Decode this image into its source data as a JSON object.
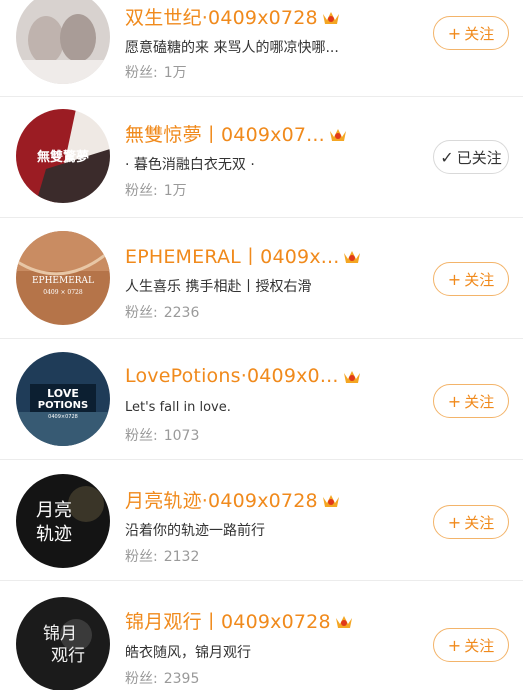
{
  "colors": {
    "name_orange": "#f08a1c",
    "follow_border": "#f3b46a",
    "fans_gray": "#9a9a9a",
    "followed_border": "#d9d9d9"
  },
  "fans_label": "粉丝:",
  "items": [
    {
      "name": "双生世纪·0409x0728",
      "bio": "愿意磕糖的来 来骂人的哪凉快哪...",
      "fans": "1万",
      "button": {
        "icon": "+",
        "label": "关注"
      }
    },
    {
      "name": "無雙惊夢丨0409x07...",
      "bio": "· 暮色消融白衣无双 ·",
      "fans": "1万",
      "button": {
        "icon": "✓",
        "label": "已关注"
      },
      "avatar_text": "無雙驚夢"
    },
    {
      "name": "EPHEMERAL丨0409x...",
      "bio": "人生喜乐 携手相赴丨授权右滑",
      "fans": "2236",
      "button": {
        "icon": "+",
        "label": "关注"
      },
      "avatar_text": "EPHEMERAL",
      "avatar_sub": "0409 × 0728"
    },
    {
      "name": "LovePotions·0409x0...",
      "bio": "Let's fall in love.",
      "fans": "1073",
      "button": {
        "icon": "+",
        "label": "关注"
      },
      "avatar_text": "LOVE",
      "avatar_text2": "POTIONS",
      "avatar_sub": "0409×0728"
    },
    {
      "name": "月亮轨迹·0409x0728",
      "bio": "沿着你的轨迹一路前行",
      "fans": "2132",
      "button": {
        "icon": "+",
        "label": "关注"
      },
      "avatar_text": "月亮",
      "avatar_text2": "轨迹"
    },
    {
      "name": "锦月观行丨0409x0728",
      "bio": "皓衣随风，锦月观行",
      "fans": "2395",
      "button": {
        "icon": "+",
        "label": "关注"
      },
      "avatar_text": "锦月",
      "avatar_text2": "观行"
    }
  ]
}
